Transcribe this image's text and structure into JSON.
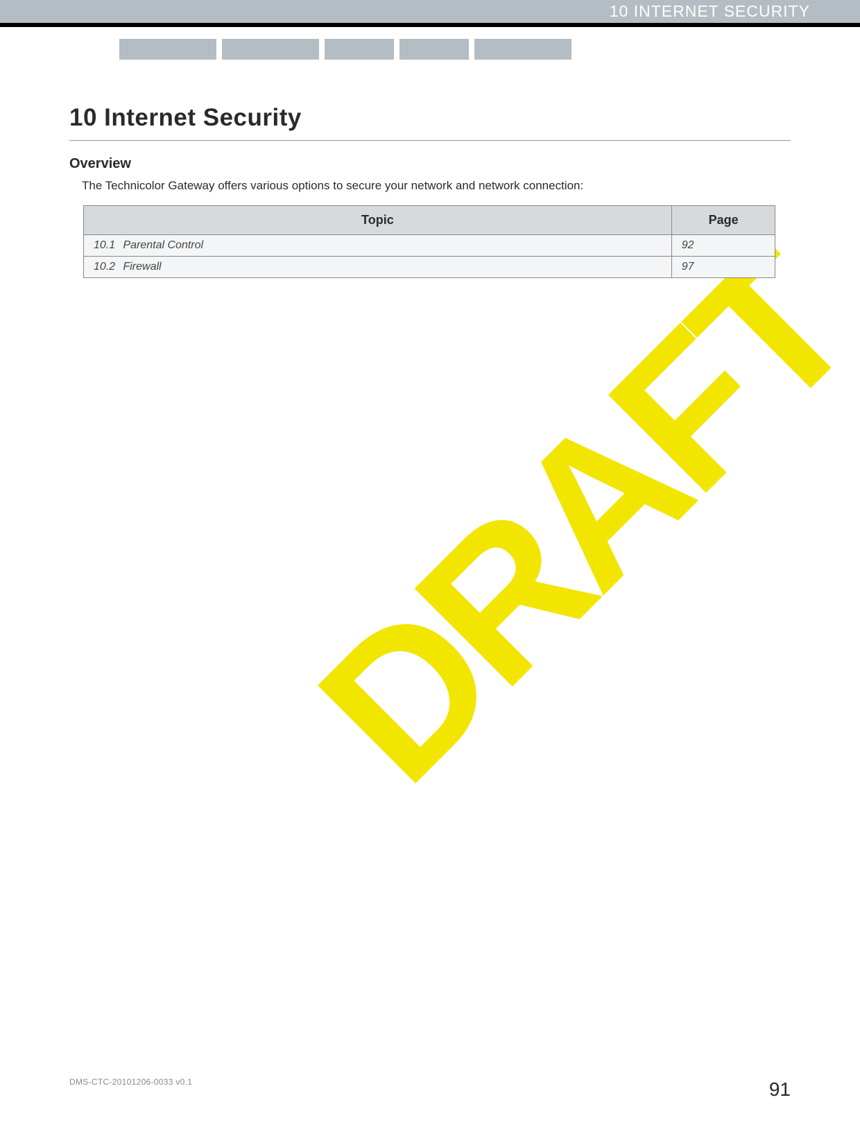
{
  "header": {
    "title": "10 INTERNET SECURITY"
  },
  "chapter": {
    "title": "10 Internet Security"
  },
  "section": {
    "heading": "Overview",
    "body": "The Technicolor Gateway offers various options to secure your network and network connection:"
  },
  "table": {
    "headers": {
      "topic": "Topic",
      "page": "Page"
    },
    "rows": [
      {
        "num": "10.1",
        "topic": "Parental Control",
        "page": "92"
      },
      {
        "num": "10.2",
        "topic": "Firewall",
        "page": "97"
      }
    ]
  },
  "watermark": "DRAFT",
  "footer": {
    "doc_id": "DMS-CTC-20101206-0033 v0.1",
    "page_number": "91"
  }
}
